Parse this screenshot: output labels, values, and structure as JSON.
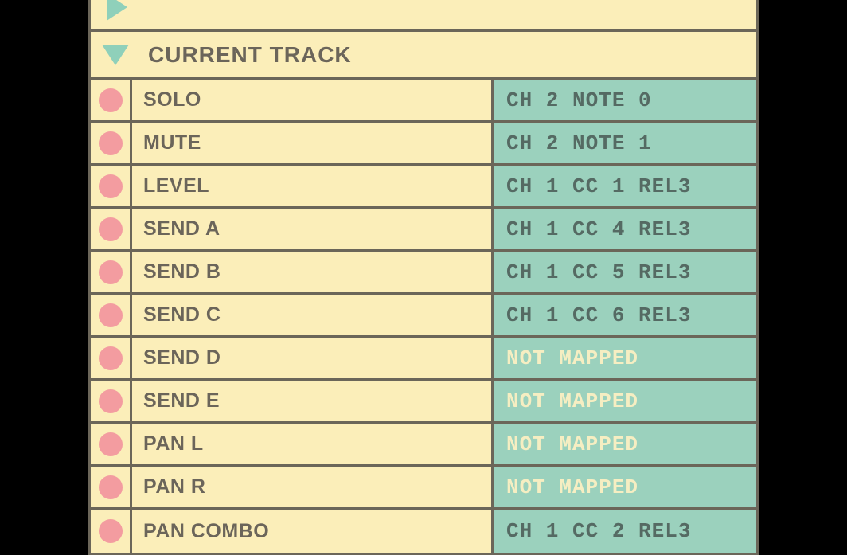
{
  "prev_section_title": "",
  "section_title": "CURRENT TRACK",
  "rows": [
    {
      "label": "SOLO",
      "mapping": "CH 2 NOTE 0",
      "mapped": true
    },
    {
      "label": "MUTE",
      "mapping": "CH 2 NOTE 1",
      "mapped": true
    },
    {
      "label": "LEVEL",
      "mapping": "CH 1 CC 1 REL3",
      "mapped": true
    },
    {
      "label": "SEND A",
      "mapping": "CH 1 CC 4 REL3",
      "mapped": true
    },
    {
      "label": "SEND B",
      "mapping": "CH 1 CC 5 REL3",
      "mapped": true
    },
    {
      "label": "SEND C",
      "mapping": "CH 1 CC 6 REL3",
      "mapped": true
    },
    {
      "label": "SEND D",
      "mapping": "NOT MAPPED",
      "mapped": false
    },
    {
      "label": "SEND E",
      "mapping": "NOT MAPPED",
      "mapped": false
    },
    {
      "label": "PAN L",
      "mapping": "NOT MAPPED",
      "mapped": false
    },
    {
      "label": "PAN R",
      "mapping": "NOT MAPPED",
      "mapped": false
    },
    {
      "label": "PAN COMBO",
      "mapping": "CH 1 CC 2 REL3",
      "mapped": true
    }
  ]
}
